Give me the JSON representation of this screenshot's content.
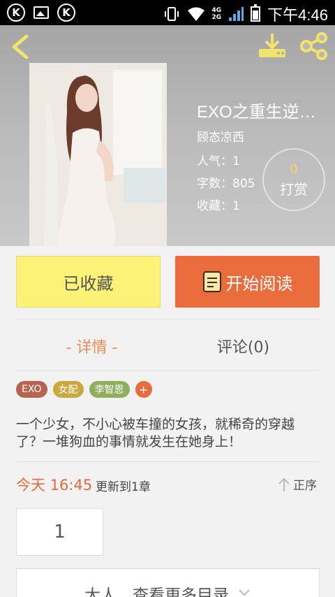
{
  "status_bar": {
    "time": "下午4:46",
    "network_labels": [
      "4G",
      "2G"
    ]
  },
  "book": {
    "title": "EXO之重生逆…",
    "author": "顾态凉西",
    "popularity": "人气：1",
    "word_count": "字数：805",
    "collections": "收藏：1"
  },
  "tip": {
    "count": "0",
    "label": "打赏"
  },
  "actions": {
    "collected_label": "已收藏",
    "read_label": "开始阅读"
  },
  "tabs": {
    "detail": "- 详情 -",
    "comments": "评论(0)"
  },
  "tags": [
    {
      "label": "EXO",
      "color": "#b5654f"
    },
    {
      "label": "女配",
      "color": "#c8a83f"
    },
    {
      "label": "李智恩",
      "color": "#8fae5e"
    }
  ],
  "tag_add": "+",
  "synopsis": "一个少女，不小心被车撞的女孩，就稀奇的穿越了？一堆狗血的事情就发生在她身上！",
  "update": {
    "time": "今天 16:45",
    "text": "更新到1章"
  },
  "sort_label": "正序",
  "page_number": "1",
  "more_catalog": "大人，查看更多目录",
  "colors": {
    "accent_orange": "#ea6c3d",
    "collected_yellow": "#fbf277",
    "tip_gold": "#f5d66a"
  }
}
